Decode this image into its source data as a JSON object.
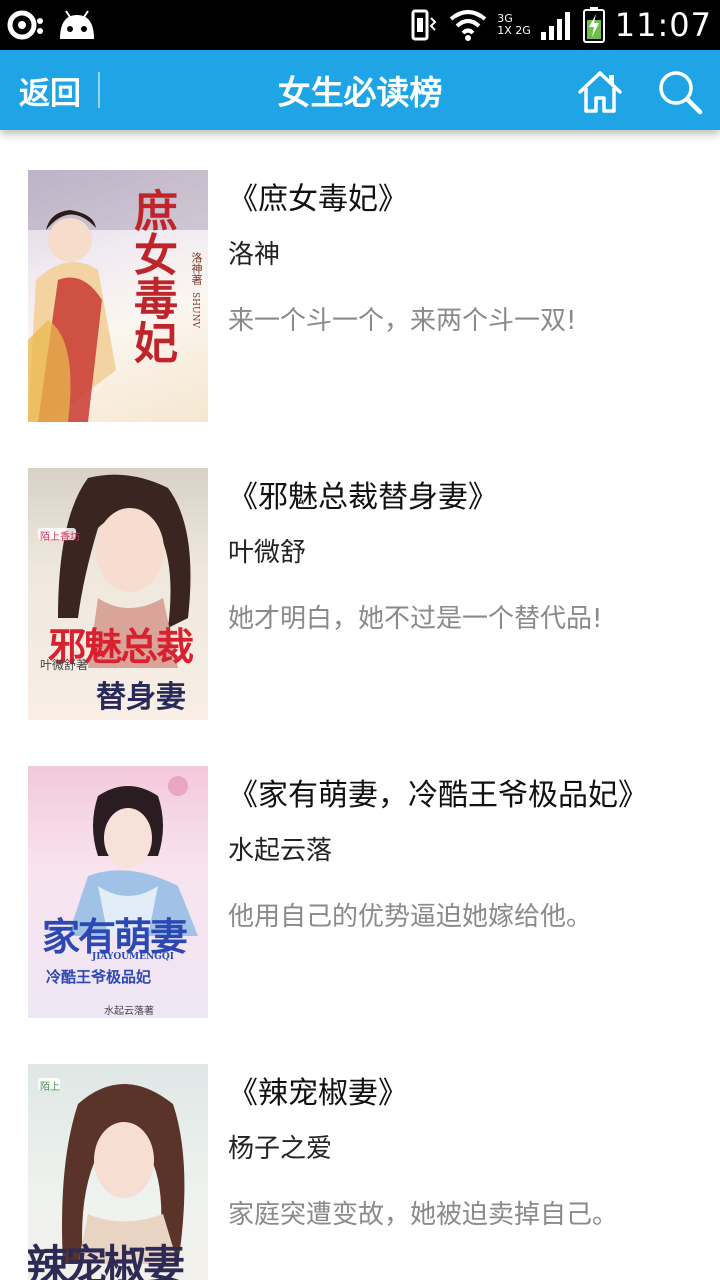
{
  "status_bar": {
    "time": "11:07",
    "network_top": "3G",
    "network_bottom": "1X",
    "network_bottom_2": "2G",
    "icons": [
      "android-notification-icon",
      "android-robot-icon",
      "vibrate-icon",
      "wifi-icon",
      "signal-icon",
      "battery-charging-icon"
    ]
  },
  "header": {
    "back_label": "返回",
    "title": "女生必读榜",
    "home_icon": "home-icon",
    "search_icon": "search-icon",
    "background": "#1fa5e6"
  },
  "books": [
    {
      "title": "《庶女毒妃》",
      "author": "洛神",
      "description": "来一个斗一个，来两个斗一双!",
      "cover_text": "庶女毒妃",
      "cover_author": "洛神著",
      "cover_pinyin": "SHUNV"
    },
    {
      "title": "《邪魅总裁替身妻》",
      "author": "叶微舒",
      "description": "她才明白，她不过是一个替代品!",
      "cover_text": "邪魅总裁",
      "cover_text_2": "替身妻",
      "cover_author": "叶微舒著",
      "cover_badge": "陌上香坊"
    },
    {
      "title": "《家有萌妻，冷酷王爷极品妃》",
      "author": "水起云落",
      "description": "他用自己的优势逼迫她嫁给他。",
      "cover_text": "家有萌妻",
      "cover_pinyin": "JIAYOUMENGQI",
      "cover_subtitle": "冷酷王爷极品妃",
      "cover_author": "水起云落著"
    },
    {
      "title": "《辣宠椒妻》",
      "author": "杨子之爱",
      "description": "家庭突遭变故，她被迫卖掉自己。",
      "cover_text": "辣宠椒妻",
      "cover_badge": "陌上"
    }
  ]
}
